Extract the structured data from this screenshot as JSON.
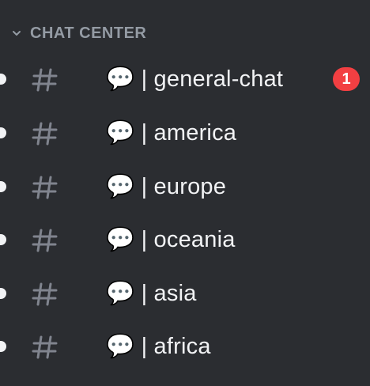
{
  "category": {
    "label": "CHAT CENTER",
    "icon": "chevron-down-icon"
  },
  "colors": {
    "background": "#2b2d31",
    "channel_text": "#f2f3f5",
    "category_text": "#949ba4",
    "hash_icon": "#80848e",
    "mention_badge": "#f23f42"
  },
  "channels": [
    {
      "name": "💬 | general-chat",
      "unread": true,
      "mentions": "1"
    },
    {
      "name": "💬 | america",
      "unread": true
    },
    {
      "name": "💬 | europe",
      "unread": true
    },
    {
      "name": "💬 | oceania",
      "unread": true
    },
    {
      "name": "💬 | asia",
      "unread": true
    },
    {
      "name": "💬 | africa",
      "unread": true
    }
  ]
}
